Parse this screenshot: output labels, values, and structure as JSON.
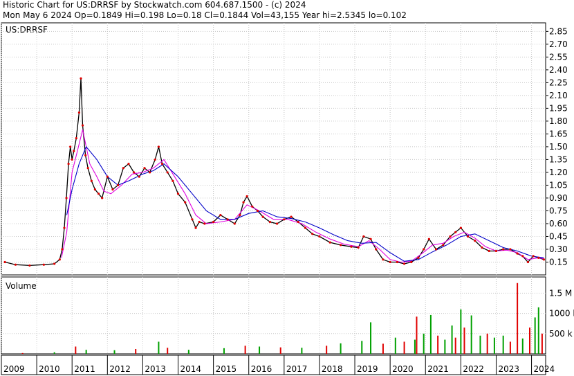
{
  "header": {
    "line1": "Historic Chart for US:DRRSF by Stockwatch.com 604.687.1500 - (c) 2024",
    "line2": "Mon May  6 2024   Op=0.1849   Hi=0.198   Lo=0.18   Cl=0.1844   Vol=43,155   Year hi=2.5345   lo=0.102"
  },
  "chart_data": [
    {
      "type": "line",
      "title": "US:DRRSF",
      "ylim": [
        0.0,
        2.95
      ],
      "y_ticks": [
        "2.85",
        "2.70",
        "2.55",
        "2.40",
        "2.25",
        "2.10",
        "1.95",
        "1.80",
        "1.65",
        "1.50",
        "1.35",
        "1.20",
        "1.05",
        "0.90",
        "0.75",
        "0.60",
        "0.45",
        "0.30",
        "0.15"
      ],
      "y_tick_values": [
        2.85,
        2.7,
        2.55,
        2.4,
        2.25,
        2.1,
        1.95,
        1.8,
        1.65,
        1.5,
        1.35,
        1.2,
        1.05,
        0.9,
        0.75,
        0.6,
        0.45,
        0.3,
        0.15
      ],
      "xlim": [
        2009.0,
        2024.4
      ],
      "x_ticks": [
        "2009",
        "2010",
        "2011",
        "2012",
        "2013",
        "2014",
        "2015",
        "2016",
        "2017",
        "2018",
        "2019",
        "2020",
        "2021",
        "2022",
        "2023",
        "2024"
      ],
      "x_tick_values": [
        2009,
        2010,
        2011,
        2012,
        2013,
        2014,
        2015,
        2016,
        2017,
        2018,
        2019,
        2020,
        2021,
        2022,
        2023,
        2024
      ],
      "series": [
        {
          "key": "price",
          "color": "#000000",
          "x": [
            2009.1,
            2009.4,
            2009.8,
            2010.2,
            2010.5,
            2010.65,
            2010.72,
            2010.78,
            2010.84,
            2010.9,
            2010.95,
            2011.0,
            2011.05,
            2011.12,
            2011.2,
            2011.25,
            2011.3,
            2011.38,
            2011.45,
            2011.55,
            2011.65,
            2011.75,
            2011.85,
            2012.0,
            2012.15,
            2012.3,
            2012.45,
            2012.6,
            2012.75,
            2012.9,
            2013.05,
            2013.2,
            2013.35,
            2013.45,
            2013.55,
            2013.7,
            2013.85,
            2014.0,
            2014.2,
            2014.4,
            2014.5,
            2014.6,
            2014.75,
            2015.0,
            2015.2,
            2015.4,
            2015.6,
            2015.75,
            2015.85,
            2015.95,
            2016.1,
            2016.25,
            2016.4,
            2016.6,
            2016.8,
            2017.0,
            2017.2,
            2017.4,
            2017.6,
            2017.8,
            2018.0,
            2018.3,
            2018.6,
            2018.9,
            2019.1,
            2019.25,
            2019.45,
            2019.6,
            2019.8,
            2020.0,
            2020.2,
            2020.4,
            2020.6,
            2020.8,
            2020.95,
            2021.1,
            2021.3,
            2021.5,
            2021.7,
            2021.85,
            2022.0,
            2022.2,
            2022.4,
            2022.6,
            2022.8,
            2023.0,
            2023.2,
            2023.4,
            2023.6,
            2023.75,
            2023.9,
            2024.05,
            2024.2,
            2024.35
          ],
          "y": [
            0.15,
            0.12,
            0.11,
            0.12,
            0.13,
            0.18,
            0.3,
            0.55,
            0.9,
            1.3,
            1.5,
            1.35,
            1.45,
            1.6,
            1.9,
            2.3,
            1.75,
            1.4,
            1.25,
            1.1,
            1.0,
            0.95,
            0.9,
            1.15,
            1.0,
            1.05,
            1.25,
            1.3,
            1.2,
            1.15,
            1.25,
            1.2,
            1.35,
            1.5,
            1.3,
            1.2,
            1.1,
            0.95,
            0.85,
            0.65,
            0.55,
            0.62,
            0.6,
            0.62,
            0.7,
            0.65,
            0.6,
            0.7,
            0.85,
            0.92,
            0.8,
            0.75,
            0.68,
            0.62,
            0.6,
            0.65,
            0.68,
            0.62,
            0.55,
            0.48,
            0.45,
            0.38,
            0.35,
            0.33,
            0.32,
            0.45,
            0.42,
            0.3,
            0.18,
            0.15,
            0.15,
            0.13,
            0.15,
            0.2,
            0.3,
            0.42,
            0.3,
            0.35,
            0.45,
            0.5,
            0.55,
            0.45,
            0.4,
            0.32,
            0.28,
            0.28,
            0.3,
            0.3,
            0.25,
            0.22,
            0.15,
            0.22,
            0.2,
            0.18
          ]
        },
        {
          "key": "ma_short",
          "color": "#e000e0",
          "x": [
            2010.7,
            2010.85,
            2011.0,
            2011.15,
            2011.3,
            2011.5,
            2011.7,
            2011.9,
            2012.1,
            2012.4,
            2012.7,
            2013.0,
            2013.3,
            2013.6,
            2013.9,
            2014.2,
            2014.5,
            2014.8,
            2015.2,
            2015.6,
            2015.95,
            2016.3,
            2016.7,
            2017.1,
            2017.5,
            2017.9,
            2018.3,
            2018.7,
            2019.1,
            2019.4,
            2019.7,
            2020.0,
            2020.3,
            2020.6,
            2020.9,
            2021.2,
            2021.5,
            2021.8,
            2022.1,
            2022.4,
            2022.7,
            2023.0,
            2023.3,
            2023.6,
            2023.9,
            2024.2,
            2024.35
          ],
          "y": [
            0.2,
            0.5,
            1.2,
            1.45,
            1.7,
            1.3,
            1.15,
            0.98,
            0.95,
            1.05,
            1.18,
            1.2,
            1.25,
            1.35,
            1.15,
            0.95,
            0.7,
            0.6,
            0.62,
            0.65,
            0.82,
            0.75,
            0.65,
            0.65,
            0.6,
            0.5,
            0.42,
            0.36,
            0.33,
            0.4,
            0.3,
            0.18,
            0.15,
            0.16,
            0.25,
            0.35,
            0.37,
            0.45,
            0.5,
            0.43,
            0.33,
            0.28,
            0.29,
            0.26,
            0.18,
            0.2,
            0.19
          ]
        },
        {
          "key": "ma_long",
          "color": "#0000c8",
          "x": [
            2010.85,
            2011.0,
            2011.2,
            2011.4,
            2011.7,
            2012.0,
            2012.3,
            2012.6,
            2013.0,
            2013.3,
            2013.6,
            2014.0,
            2014.4,
            2014.8,
            2015.2,
            2015.6,
            2016.0,
            2016.4,
            2016.8,
            2017.2,
            2017.6,
            2018.0,
            2018.4,
            2018.8,
            2019.2,
            2019.6,
            2020.0,
            2020.4,
            2020.8,
            2021.2,
            2021.6,
            2022.0,
            2022.4,
            2022.8,
            2023.2,
            2023.6,
            2024.0,
            2024.35
          ],
          "y": [
            0.7,
            1.0,
            1.3,
            1.5,
            1.35,
            1.15,
            1.05,
            1.1,
            1.18,
            1.22,
            1.3,
            1.15,
            0.95,
            0.75,
            0.65,
            0.65,
            0.72,
            0.75,
            0.68,
            0.66,
            0.62,
            0.55,
            0.47,
            0.4,
            0.37,
            0.38,
            0.26,
            0.16,
            0.18,
            0.27,
            0.35,
            0.45,
            0.48,
            0.4,
            0.32,
            0.28,
            0.22,
            0.2
          ]
        }
      ]
    },
    {
      "type": "bar",
      "title": "Volume",
      "ylim": [
        0,
        1900000
      ],
      "y_ticks": [
        "1.5 M",
        "1000 k",
        "500 k"
      ],
      "y_tick_values": [
        1500000,
        1000000,
        500000
      ],
      "colors": {
        "up": "#00a000",
        "down": "#e00000"
      },
      "samples": [
        {
          "x": 2009.6,
          "v": 20000,
          "c": "down"
        },
        {
          "x": 2010.5,
          "v": 40000,
          "c": "up"
        },
        {
          "x": 2011.1,
          "v": 180000,
          "c": "down"
        },
        {
          "x": 2011.4,
          "v": 100000,
          "c": "up"
        },
        {
          "x": 2012.2,
          "v": 90000,
          "c": "up"
        },
        {
          "x": 2012.8,
          "v": 120000,
          "c": "down"
        },
        {
          "x": 2013.45,
          "v": 300000,
          "c": "up"
        },
        {
          "x": 2013.7,
          "v": 150000,
          "c": "down"
        },
        {
          "x": 2014.3,
          "v": 100000,
          "c": "up"
        },
        {
          "x": 2015.3,
          "v": 140000,
          "c": "up"
        },
        {
          "x": 2015.9,
          "v": 200000,
          "c": "down"
        },
        {
          "x": 2016.3,
          "v": 180000,
          "c": "up"
        },
        {
          "x": 2016.9,
          "v": 160000,
          "c": "down"
        },
        {
          "x": 2017.5,
          "v": 150000,
          "c": "up"
        },
        {
          "x": 2018.2,
          "v": 200000,
          "c": "down"
        },
        {
          "x": 2018.6,
          "v": 260000,
          "c": "up"
        },
        {
          "x": 2019.2,
          "v": 320000,
          "c": "up"
        },
        {
          "x": 2019.45,
          "v": 780000,
          "c": "up"
        },
        {
          "x": 2019.8,
          "v": 250000,
          "c": "down"
        },
        {
          "x": 2020.15,
          "v": 400000,
          "c": "up"
        },
        {
          "x": 2020.4,
          "v": 300000,
          "c": "down"
        },
        {
          "x": 2020.7,
          "v": 350000,
          "c": "up"
        },
        {
          "x": 2020.75,
          "v": 920000,
          "c": "down"
        },
        {
          "x": 2020.95,
          "v": 500000,
          "c": "up"
        },
        {
          "x": 2021.15,
          "v": 960000,
          "c": "up"
        },
        {
          "x": 2021.35,
          "v": 450000,
          "c": "down"
        },
        {
          "x": 2021.55,
          "v": 350000,
          "c": "up"
        },
        {
          "x": 2021.75,
          "v": 700000,
          "c": "up"
        },
        {
          "x": 2021.85,
          "v": 400000,
          "c": "down"
        },
        {
          "x": 2022.0,
          "v": 1100000,
          "c": "up"
        },
        {
          "x": 2022.1,
          "v": 650000,
          "c": "down"
        },
        {
          "x": 2022.3,
          "v": 950000,
          "c": "up"
        },
        {
          "x": 2022.55,
          "v": 450000,
          "c": "up"
        },
        {
          "x": 2022.75,
          "v": 500000,
          "c": "down"
        },
        {
          "x": 2022.95,
          "v": 400000,
          "c": "up"
        },
        {
          "x": 2023.2,
          "v": 450000,
          "c": "up"
        },
        {
          "x": 2023.4,
          "v": 300000,
          "c": "down"
        },
        {
          "x": 2023.6,
          "v": 1750000,
          "c": "down"
        },
        {
          "x": 2023.75,
          "v": 380000,
          "c": "up"
        },
        {
          "x": 2023.95,
          "v": 650000,
          "c": "down"
        },
        {
          "x": 2024.1,
          "v": 900000,
          "c": "up"
        },
        {
          "x": 2024.2,
          "v": 1150000,
          "c": "up"
        },
        {
          "x": 2024.3,
          "v": 500000,
          "c": "down"
        }
      ]
    }
  ]
}
